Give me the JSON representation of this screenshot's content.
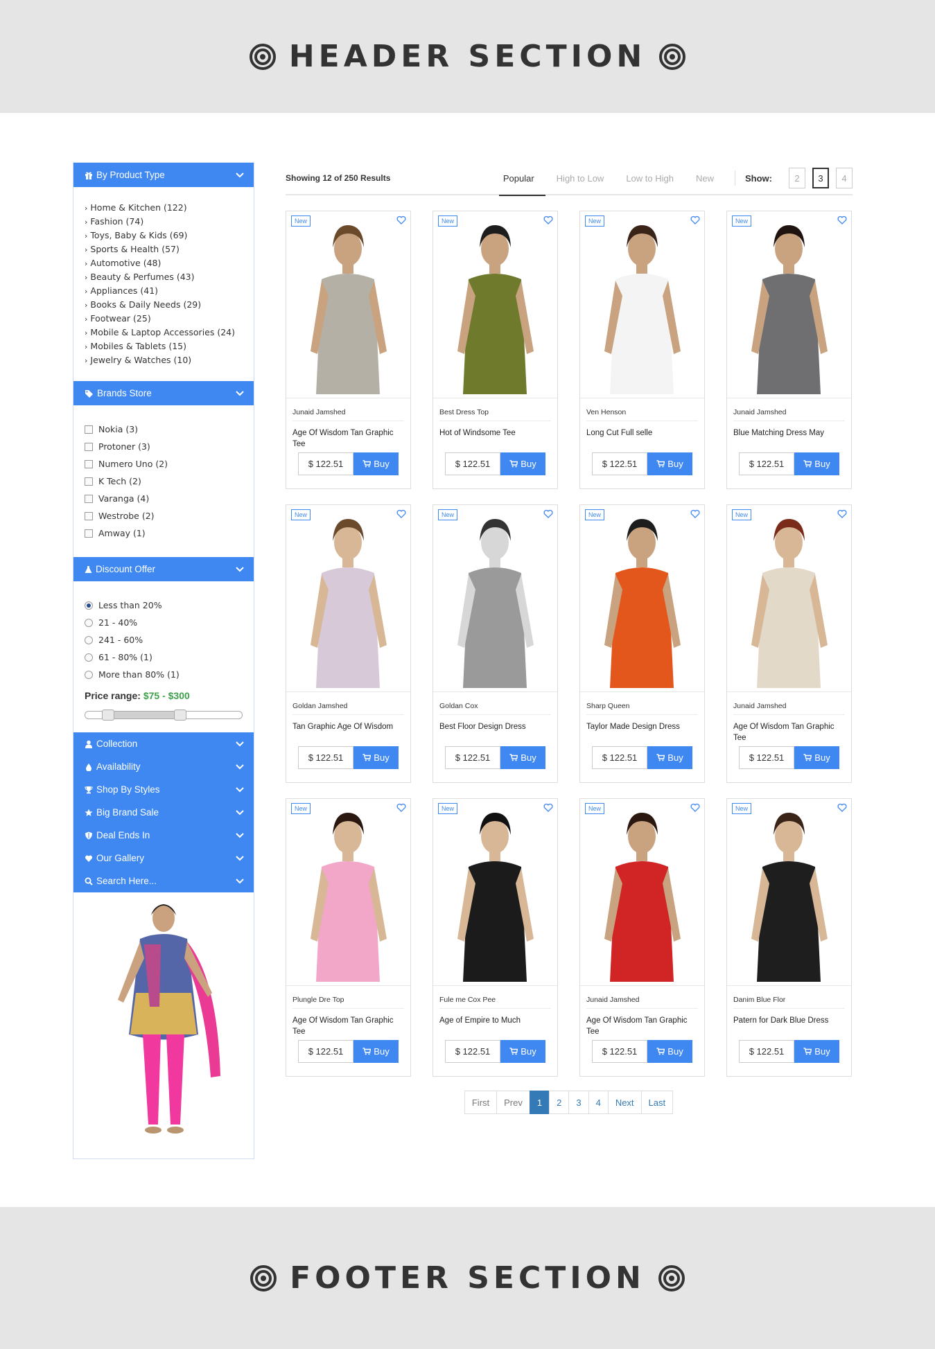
{
  "header": {
    "title": "HEADER SECTION"
  },
  "footer": {
    "title": "FOOTER SECTION"
  },
  "sidebar": {
    "product_type": {
      "title": "By Product Type",
      "items": [
        "Home & Kitchen (122)",
        "Fashion (74)",
        "Toys, Baby & Kids (69)",
        "Sports & Health (57)",
        "Automotive (48)",
        "Beauty & Perfumes (43)",
        "Appliances (41)",
        "Books & Daily Needs (29)",
        "Footwear (25)",
        "Mobile & Laptop Accessories (24)",
        "Mobiles & Tablets (15)",
        "Jewelry & Watches (10)"
      ]
    },
    "brands": {
      "title": "Brands Store",
      "items": [
        "Nokia (3)",
        "Protoner (3)",
        "Numero Uno (2)",
        "K Tech (2)",
        "Varanga (4)",
        "Westrobe (2)",
        "Amway (1)"
      ]
    },
    "discount": {
      "title": "Discount Offer",
      "items": [
        "Less than 20%",
        "21 - 40%",
        "241 - 60%",
        "61 - 80% (1)",
        "More than 80% (1)"
      ],
      "selected_index": 0,
      "price_label": "Price range:",
      "price_value": "$75 - $300"
    },
    "collapsed": [
      "Collection",
      "Availability",
      "Shop By Styles",
      "Big Brand Sale",
      "Deal Ends In",
      "Our Gallery",
      "Search Here..."
    ]
  },
  "toolbar": {
    "results": "Showing 12 of 250 Results",
    "sort_tabs": [
      "Popular",
      "High to Low",
      "Low to High",
      "New"
    ],
    "active_sort": "Popular",
    "show_label": "Show:",
    "show_options": [
      "2",
      "3",
      "4"
    ],
    "active_show": "3"
  },
  "products": [
    {
      "badge": "New",
      "brand": "Junaid Jamshed",
      "name": "Age Of Wisdom Tan Graphic Tee",
      "price": "$ 122.51",
      "buy": "Buy"
    },
    {
      "badge": "New",
      "brand": "Best Dress Top",
      "name": "Hot of Windsome Tee",
      "price": "$ 122.51",
      "buy": "Buy"
    },
    {
      "badge": "New",
      "brand": "Ven Henson",
      "name": "Long Cut Full selle",
      "price": "$ 122.51",
      "buy": "Buy"
    },
    {
      "badge": "New",
      "brand": "Junaid Jamshed",
      "name": "Blue Matching Dress May",
      "price": "$ 122.51",
      "buy": "Buy"
    },
    {
      "badge": "New",
      "brand": "Goldan Jamshed",
      "name": "Tan Graphic Age Of Wisdom",
      "price": "$ 122.51",
      "buy": "Buy"
    },
    {
      "badge": "New",
      "brand": "Goldan Cox",
      "name": "Best Floor Design Dress",
      "price": "$ 122.51",
      "buy": "Buy"
    },
    {
      "badge": "New",
      "brand": "Sharp Queen",
      "name": "Taylor Made Design Dress",
      "price": "$ 122.51",
      "buy": "Buy"
    },
    {
      "badge": "New",
      "brand": "Junaid Jamshed",
      "name": "Age Of Wisdom Tan Graphic Tee",
      "price": "$ 122.51",
      "buy": "Buy"
    },
    {
      "badge": "New",
      "brand": "Plungle Dre Top",
      "name": "Age Of Wisdom Tan Graphic Tee",
      "price": "$ 122.51",
      "buy": "Buy"
    },
    {
      "badge": "New",
      "brand": "Fule me Cox Pee",
      "name": "Age of Empire to Much",
      "price": "$ 122.51",
      "buy": "Buy"
    },
    {
      "badge": "New",
      "brand": "Junaid Jamshed",
      "name": "Age Of Wisdom Tan Graphic Tee",
      "price": "$ 122.51",
      "buy": "Buy"
    },
    {
      "badge": "New",
      "brand": "Danim Blue Flor",
      "name": "Patern for Dark Blue Dress",
      "price": "$ 122.51",
      "buy": "Buy"
    }
  ],
  "pagination": {
    "items": [
      "First",
      "Prev",
      "1",
      "2",
      "3",
      "4",
      "Next",
      "Last"
    ],
    "active": "1"
  },
  "colors": {
    "accent": "#3f88f2",
    "pager_active": "#337ab7",
    "price_value": "#3da14a"
  },
  "icons": [
    "target-icon",
    "gift-icon",
    "tags-icon",
    "flask-icon",
    "user-icon",
    "tint-icon",
    "trophy-icon",
    "star-icon",
    "shield-icon",
    "heart-icon",
    "search-icon",
    "chevron-down-icon",
    "cart-icon"
  ]
}
